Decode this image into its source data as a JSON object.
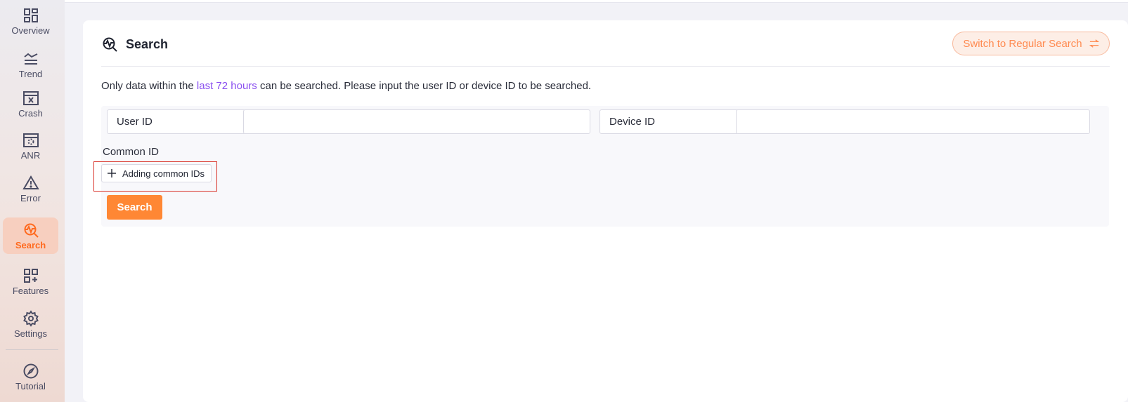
{
  "sidebar": {
    "items": [
      {
        "label": "Overview",
        "icon": "grid-icon"
      },
      {
        "label": "Trend",
        "icon": "trend-icon"
      },
      {
        "label": "Crash",
        "icon": "crash-window-icon"
      },
      {
        "label": "ANR",
        "icon": "anr-window-icon"
      },
      {
        "label": "Error",
        "icon": "warning-icon"
      },
      {
        "label": "Search",
        "icon": "search-pulse-icon",
        "active": true
      },
      {
        "label": "Features",
        "icon": "grid-plus-icon"
      },
      {
        "label": "Settings",
        "icon": "gear-icon"
      },
      {
        "label": "Tutorial",
        "icon": "compass-icon"
      }
    ]
  },
  "page": {
    "title": "Search",
    "switch_label": "Switch to Regular Search",
    "hint_prefix": "Only data within the ",
    "hint_highlight": "last 72 hours",
    "hint_suffix": " can be searched.  Please input the user ID or device ID to be searched."
  },
  "form": {
    "user_id_label": "User ID",
    "user_id_value": "",
    "device_id_label": "Device ID",
    "device_id_value": "",
    "common_id_label": "Common ID",
    "add_common_label": "Adding common IDs",
    "search_label": "Search"
  },
  "colors": {
    "accent": "#ff8734",
    "highlight_text": "#8a4ff0",
    "annotation_box": "#d9342b"
  }
}
